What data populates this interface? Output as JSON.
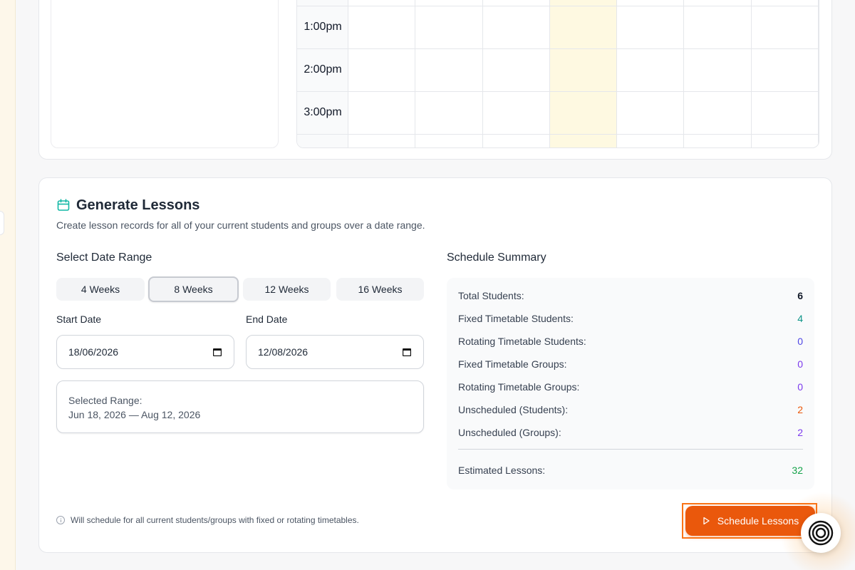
{
  "timetable": {
    "times": [
      "1:00pm",
      "2:00pm",
      "3:00pm"
    ]
  },
  "generate": {
    "title": "Generate Lessons",
    "subtitle": "Create lesson records for all of your current students and groups over a date range."
  },
  "date_range": {
    "heading": "Select Date Range",
    "presets": [
      "4 Weeks",
      "8 Weeks",
      "12 Weeks",
      "16 Weeks"
    ],
    "active_preset": "8 Weeks",
    "start_label": "Start Date",
    "start_value": "18/06/2026",
    "end_label": "End Date",
    "end_value": "12/08/2026",
    "selected_label": "Selected Range:",
    "selected_value": "Jun 18, 2026 — Aug 12, 2026"
  },
  "summary": {
    "heading": "Schedule Summary",
    "rows": [
      {
        "label": "Total Students:",
        "value": "6",
        "color": "#111827"
      },
      {
        "label": "Fixed Timetable Students:",
        "value": "4",
        "color": "#0d9488"
      },
      {
        "label": "Rotating Timetable Students:",
        "value": "0",
        "color": "#4f46e5"
      },
      {
        "label": "Fixed Timetable Groups:",
        "value": "0",
        "color": "#7c3aed"
      },
      {
        "label": "Rotating Timetable Groups:",
        "value": "0",
        "color": "#7c3aed"
      },
      {
        "label": "Unscheduled (Students):",
        "value": "2",
        "color": "#ea580c"
      },
      {
        "label": "Unscheduled (Groups):",
        "value": "2",
        "color": "#7c3aed"
      }
    ],
    "estimated_label": "Estimated Lessons:",
    "estimated_value": "32",
    "estimated_color": "#16a34a"
  },
  "footer": {
    "note": "Will schedule for all current students/groups with fixed or rotating timetables.",
    "schedule_button": "Schedule Lessons"
  },
  "colors": {
    "accent": "#ea580c",
    "teal": "#14b8a6",
    "today_column": "#fef9e1"
  },
  "icons": {
    "calendar": "calendar-icon",
    "play": "play-icon",
    "info": "info-icon"
  }
}
